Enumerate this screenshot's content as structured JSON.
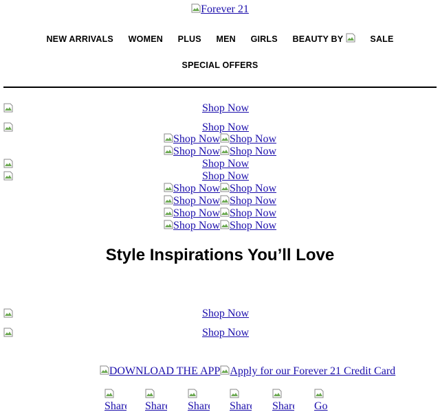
{
  "header": {
    "logo_alt": "Forever 21"
  },
  "nav": {
    "items": [
      "NEW ARRIVALS",
      "WOMEN",
      "PLUS",
      "MEN",
      "GIRLS",
      "BEAUTY BY",
      "SALE"
    ],
    "special": "SPECIAL OFFERS"
  },
  "banners": {
    "shop_now": "Shop Now"
  },
  "section": {
    "heading": "Style Inspirations You’ll Love"
  },
  "footer": {
    "download_app": "DOWNLOAD THE APP",
    "credit_card": "Apply for our Forever 21 Credit Card",
    "social": [
      "Share",
      "Share",
      "Share",
      "Share",
      "Share",
      "Go"
    ]
  },
  "icons": {
    "broken_image": "broken-image-icon"
  },
  "colors": {
    "link": "#1a0dab",
    "rule": "#000000"
  }
}
